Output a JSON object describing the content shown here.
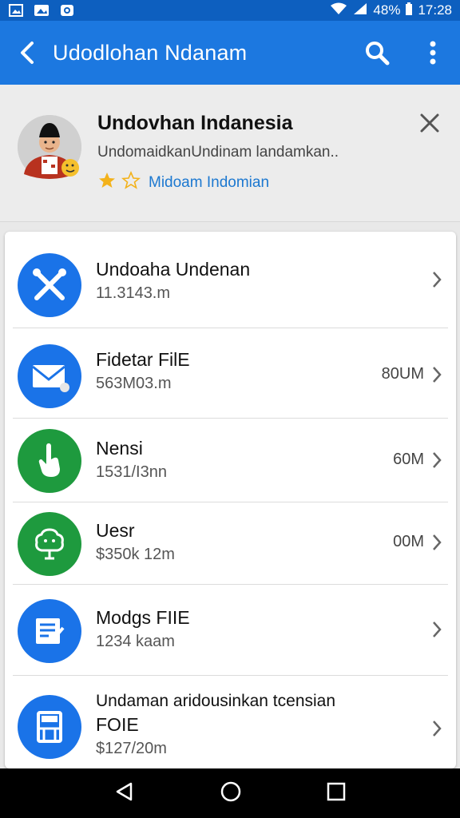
{
  "status_bar": {
    "battery": "48%",
    "time": "17:28"
  },
  "app_bar": {
    "title": "Udodlohan Ndanam"
  },
  "profile": {
    "name": "Undovhan Indanesia",
    "subtitle": "UndomaidkanUndinam landamkan..",
    "rating_label": "Midoam Indomian"
  },
  "items": [
    {
      "title": "Undoaha Undenan",
      "subtitle": "11.3143.m",
      "size": "",
      "icon": "tools-icon",
      "color": "#1a73e8"
    },
    {
      "title": "Fidetar FilE",
      "subtitle": "563M03.m",
      "size": "80UM",
      "icon": "mail-icon",
      "color": "#1a73e8"
    },
    {
      "title": "Nensi",
      "subtitle": "1531/I3nn",
      "size": "60M",
      "icon": "hand-icon",
      "color": "#1e9a3e"
    },
    {
      "title": "Uesr",
      "subtitle": "$350k 12m",
      "size": "00M",
      "icon": "tree-icon",
      "color": "#1e9a3e"
    },
    {
      "title": "Modgs FIIE",
      "subtitle": "1234 kaam",
      "size": "",
      "icon": "document-icon",
      "color": "#1a73e8"
    },
    {
      "title": "Undaman aridousinkan tcensian",
      "title2": "FOIE",
      "subtitle": "$127/20m",
      "size": "",
      "icon": "cabinet-icon",
      "color": "#1a73e8"
    }
  ]
}
